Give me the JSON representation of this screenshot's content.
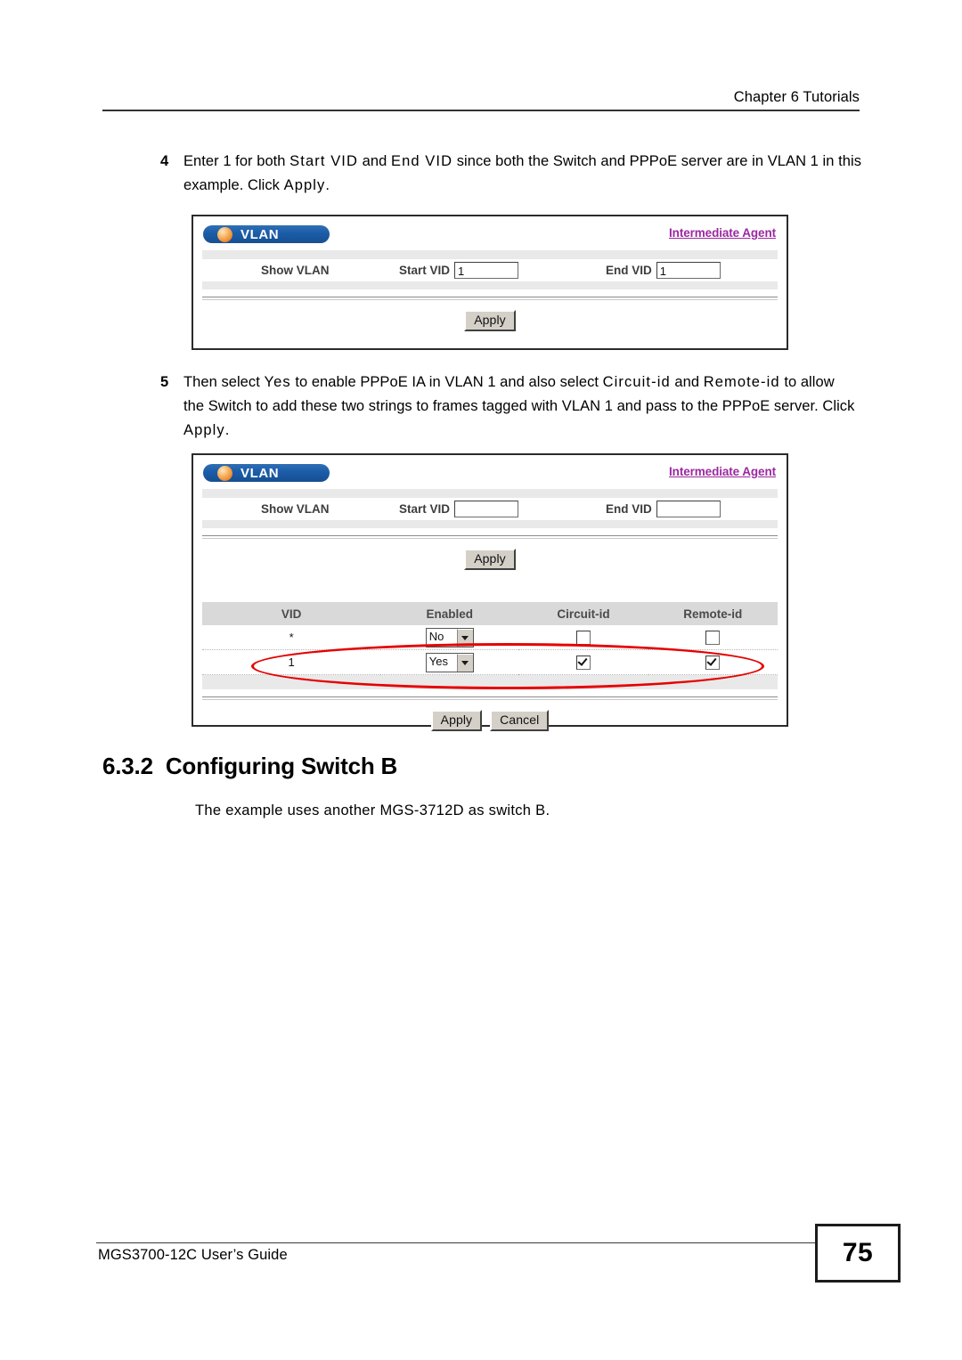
{
  "header": {
    "chapter": "Chapter 6 Tutorials"
  },
  "steps": [
    {
      "number": "4",
      "segments": [
        {
          "text": "Enter 1 for both ",
          "style": "normal"
        },
        {
          "text": "Start VID",
          "style": "ui"
        },
        {
          "text": " and ",
          "style": "normal"
        },
        {
          "text": "End VID",
          "style": "ui"
        },
        {
          "text": " since both the Switch and PPPoE server are in VLAN 1 in this example. Click ",
          "style": "normal"
        },
        {
          "text": "Apply",
          "style": "ui"
        },
        {
          "text": ".",
          "style": "normal"
        }
      ]
    },
    {
      "number": "5",
      "segments": [
        {
          "text": "Then select ",
          "style": "normal"
        },
        {
          "text": "Yes",
          "style": "ui"
        },
        {
          "text": " to enable PPPoE IA in VLAN 1 and also select ",
          "style": "normal"
        },
        {
          "text": "Circuit-id",
          "style": "ui"
        },
        {
          "text": " and ",
          "style": "normal"
        },
        {
          "text": "Remote-id",
          "style": "ui"
        },
        {
          "text": " to allow the Switch to add these two strings to frames tagged with VLAN 1 and pass to the PPPoE server. Click ",
          "style": "normal"
        },
        {
          "text": "Apply",
          "style": "ui"
        },
        {
          "text": ".",
          "style": "normal"
        }
      ]
    }
  ],
  "screenshot1": {
    "badge_label": "VLAN",
    "agent_link": "Intermediate Agent",
    "show_vlan_label": "Show VLAN",
    "start_vid_label": "Start VID",
    "start_vid_value": "1",
    "end_vid_label": "End VID",
    "end_vid_value": "1",
    "apply_label": "Apply"
  },
  "screenshot2": {
    "badge_label": "VLAN",
    "agent_link": "Intermediate Agent",
    "show_vlan_label": "Show VLAN",
    "start_vid_label": "Start VID",
    "start_vid_value": "",
    "end_vid_label": "End VID",
    "end_vid_value": "",
    "apply_label": "Apply",
    "table": {
      "columns": [
        "VID",
        "Enabled",
        "Circuit-id",
        "Remote-id"
      ],
      "rows": [
        {
          "vid": "*",
          "enabled": "No",
          "circuit_id_checked": false,
          "remote_id_checked": false
        },
        {
          "vid": "1",
          "enabled": "Yes",
          "circuit_id_checked": true,
          "remote_id_checked": true
        }
      ]
    },
    "apply_button": "Apply",
    "cancel_button": "Cancel",
    "annotation_color": "#e60000"
  },
  "section": {
    "number": "6.3.2",
    "title": "Configuring Switch B",
    "paragraph": "The example uses another MGS-3712D as switch B."
  },
  "footer": {
    "guide": "MGS3700-12C User’s Guide",
    "page_number": "75"
  }
}
